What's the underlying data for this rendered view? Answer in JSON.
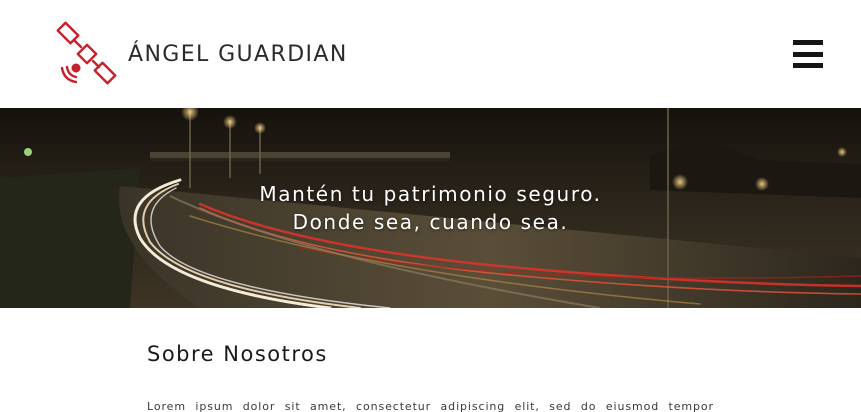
{
  "header": {
    "brand_name": "ÁNGEL GUARDIAN",
    "logo_icon": "satellite-icon",
    "menu_icon": "hamburger-menu-icon"
  },
  "hero": {
    "line1": "Mantén tu patrimonio seguro.",
    "line2": "Donde sea, cuando sea."
  },
  "about": {
    "title": "Sobre Nosotros",
    "body": "Lorem ipsum dolor sit amet, consectetur adipiscing elit, sed do eiusmod tempor"
  },
  "colors": {
    "brand_red": "#c8202a",
    "text_dark": "#2b2b2b",
    "menu_dark": "#151515",
    "header_bg": "#ffffff"
  }
}
